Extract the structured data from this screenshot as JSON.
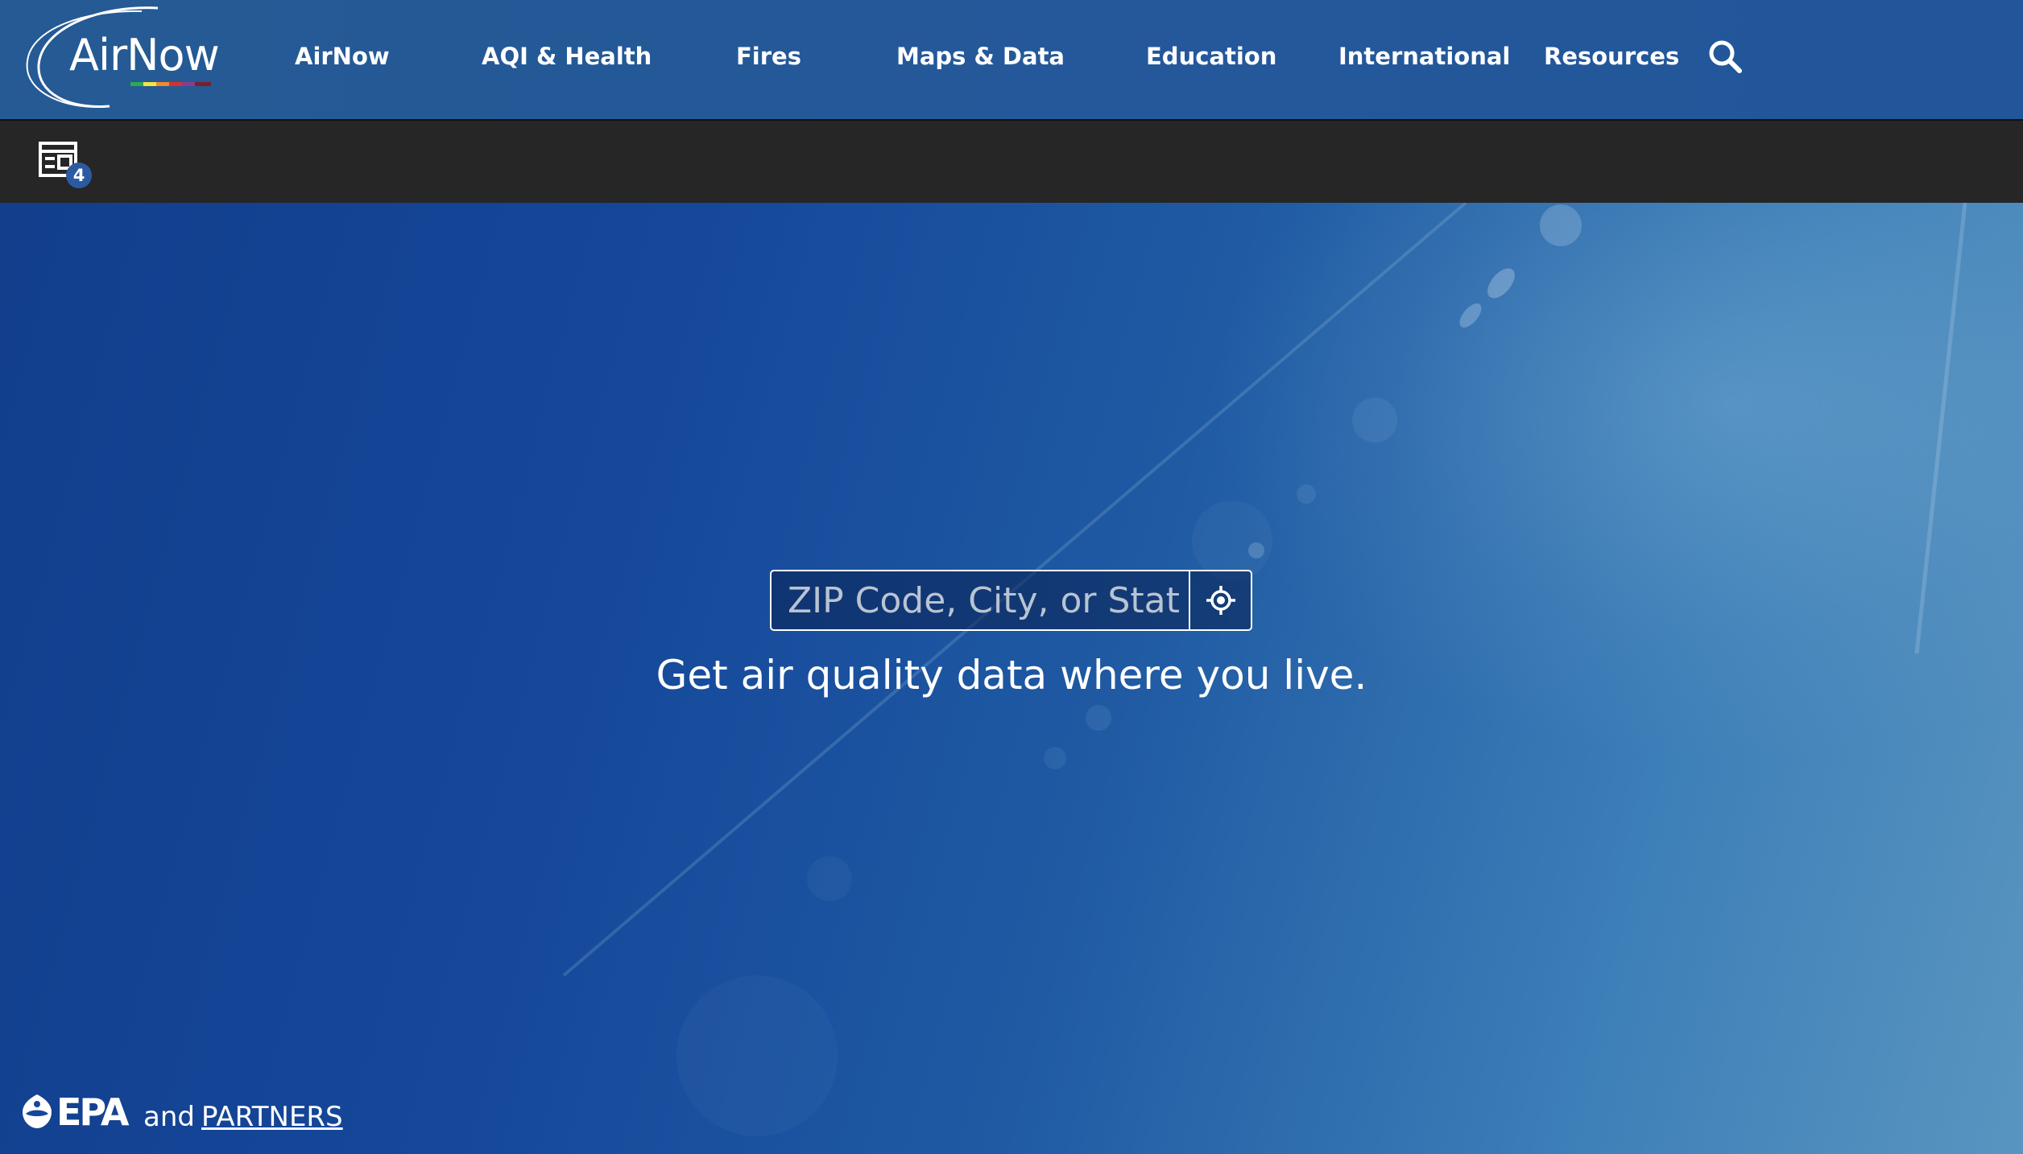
{
  "header": {
    "logo_text": "AirNow",
    "nav": [
      {
        "label": "AirNow"
      },
      {
        "label": "AQI & Health"
      },
      {
        "label": "Fires"
      },
      {
        "label": "Maps & Data"
      },
      {
        "label": "Education"
      },
      {
        "label": "International"
      },
      {
        "label": "Resources"
      }
    ],
    "search_icon": "search-icon"
  },
  "toolbar": {
    "notifications_icon": "news-list-icon",
    "notification_count": "4"
  },
  "hero": {
    "search_placeholder": "ZIP Code, City, or State",
    "locate_icon": "location-crosshair-icon",
    "tagline": "Get air quality data where you live."
  },
  "footer": {
    "epa_logo_text": "EPA",
    "and_text": "and",
    "partners_link": "PARTNERS"
  },
  "colors": {
    "nav_background": "#255a94",
    "toolbar_background": "#262626",
    "hero_background": "#17479a",
    "badge": "#2c5aa0",
    "logo_stripe": [
      "#2fa84f",
      "#f2e640",
      "#f18a2b",
      "#d9302a",
      "#8e3a8f",
      "#7a1f2e"
    ]
  }
}
